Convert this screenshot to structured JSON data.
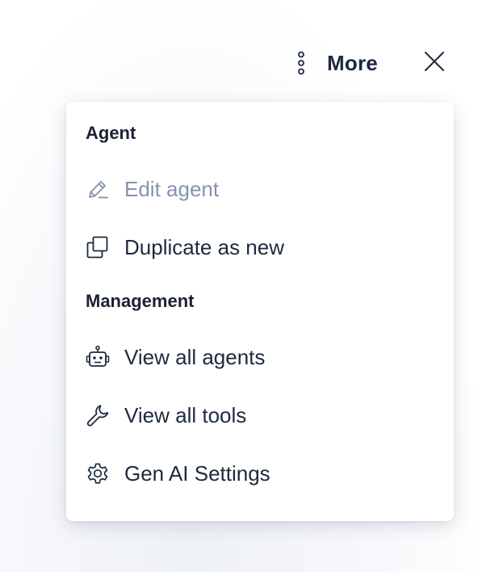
{
  "header": {
    "more_label": "More",
    "more_icon": "vertical-dots-icon",
    "close_icon": "close-icon"
  },
  "menu": {
    "sections": [
      {
        "title": "Agent",
        "items": [
          {
            "label": "Edit agent",
            "icon": "pencil-icon",
            "disabled": true
          },
          {
            "label": "Duplicate as new",
            "icon": "copy-icon",
            "disabled": false
          }
        ]
      },
      {
        "title": "Management",
        "items": [
          {
            "label": "View all agents",
            "icon": "robot-icon",
            "disabled": false
          },
          {
            "label": "View all tools",
            "icon": "wrench-icon",
            "disabled": false
          },
          {
            "label": "Gen AI Settings",
            "icon": "gear-icon",
            "disabled": false
          }
        ]
      }
    ]
  },
  "colors": {
    "text_primary": "#1d2a3e",
    "text_disabled": "#8593ab",
    "heading": "#1a2233",
    "menu_background": "#ffffff"
  }
}
